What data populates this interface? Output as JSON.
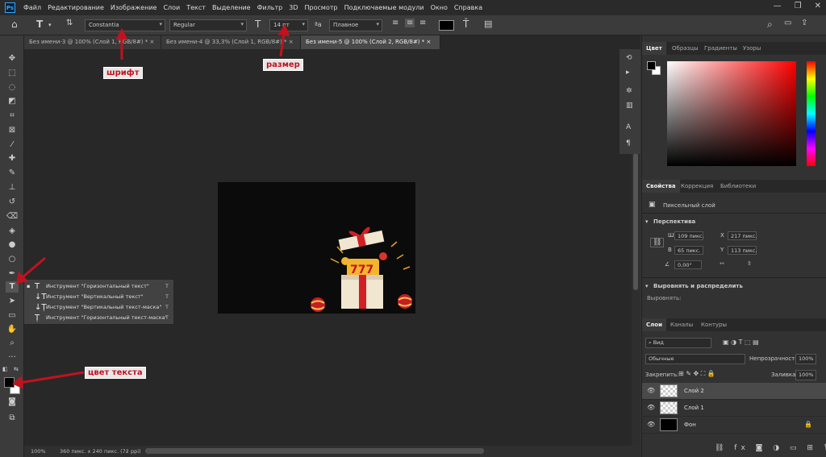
{
  "app": {
    "logo": "Ps",
    "menu": [
      "Файл",
      "Редактирование",
      "Изображение",
      "Слои",
      "Текст",
      "Выделение",
      "Фильтр",
      "3D",
      "Просмотр",
      "Подключаемые модули",
      "Окно",
      "Справка"
    ]
  },
  "options": {
    "font_family": "Constantia",
    "font_style": "Regular",
    "font_size": "14 пт",
    "antialias": "Плавное",
    "text_color": "#000000"
  },
  "tabs": [
    {
      "label": "Без имени-3 @ 100% (Слой 1, RGB/8#) *"
    },
    {
      "label": "Без имени-4 @ 33,3% (Слой 1, RGB/8#) *"
    },
    {
      "label": "Без имени-5 @ 100% (Слой 2, RGB/8#) *"
    }
  ],
  "flyout": [
    {
      "label": "Инструмент \"Горизонтальный текст\"",
      "key": "T"
    },
    {
      "label": "Инструмент \"Вертикальный текст\"",
      "key": "T"
    },
    {
      "label": "Инструмент \"Вертикальный текст-маска\"",
      "key": "T"
    },
    {
      "label": "Инструмент \"Горизонтальный текст-маска\"",
      "key": "T"
    }
  ],
  "annotations": {
    "font": "шрифт",
    "size": "размер",
    "text_color": "цвет текста",
    "color": "#c1121f"
  },
  "status": {
    "zoom": "100%",
    "doc_info": "360 пикс. x 240 пикс. (72 ppi)"
  },
  "color_panel": {
    "tabs": [
      "Цвет",
      "Образцы",
      "Градиенты",
      "Узоры"
    ]
  },
  "properties": {
    "tabs": [
      "Свойства",
      "Коррекция",
      "Библиотеки"
    ],
    "layer_type": "Пиксельный слой",
    "section_transform": "Перспектива",
    "w_label": "Ш",
    "w_value": "109 пикс.",
    "h_label": "В",
    "h_value": "65 пикс.",
    "x_label": "X",
    "x_value": "217 пикс.",
    "y_label": "Y",
    "y_value": "113 пикс.",
    "angle": "0,00°",
    "section_align": "Выровнять и распределить",
    "align_label": "Выровнять:"
  },
  "layers": {
    "tabs": [
      "Слои",
      "Каналы",
      "Контуры"
    ],
    "filter": "Вид",
    "blend_mode": "Обычные",
    "opacity_label": "Непрозрачность:",
    "opacity": "100%",
    "lock_label": "Закрепить:",
    "fill_label": "Заливка:",
    "fill": "100%",
    "items": [
      {
        "name": "Слой 2",
        "selected": true
      },
      {
        "name": "Слой 1",
        "selected": false
      },
      {
        "name": "Фон",
        "selected": false
      }
    ]
  }
}
